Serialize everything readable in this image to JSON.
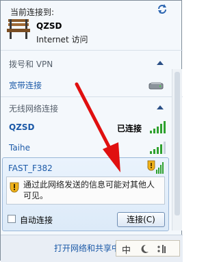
{
  "header": {
    "title": "当前连接到:"
  },
  "current_network": {
    "name": "QZSD",
    "access": "Internet 访问"
  },
  "dialup_section": {
    "title": "拨号和 VPN",
    "items": [
      {
        "label": "宽带连接"
      }
    ]
  },
  "wireless_section": {
    "title": "无线网络连接",
    "networks": [
      {
        "name": "QZSD",
        "status": "已连接"
      },
      {
        "name": "Taihe",
        "status": ""
      }
    ]
  },
  "selected_network": {
    "name": "FAST_F382",
    "warning": "通过此网络发送的信息可能对其他人可见。",
    "auto_connect_label": "自动连接",
    "auto_connect_checked": false,
    "connect_button": "连接(C)"
  },
  "footer": {
    "link": "打开网络和共享中心"
  },
  "ime": {
    "label": "中"
  },
  "colors": {
    "link": "#1c5aa8",
    "arrow": "#e01010",
    "signal_green": "#2fa12f"
  }
}
